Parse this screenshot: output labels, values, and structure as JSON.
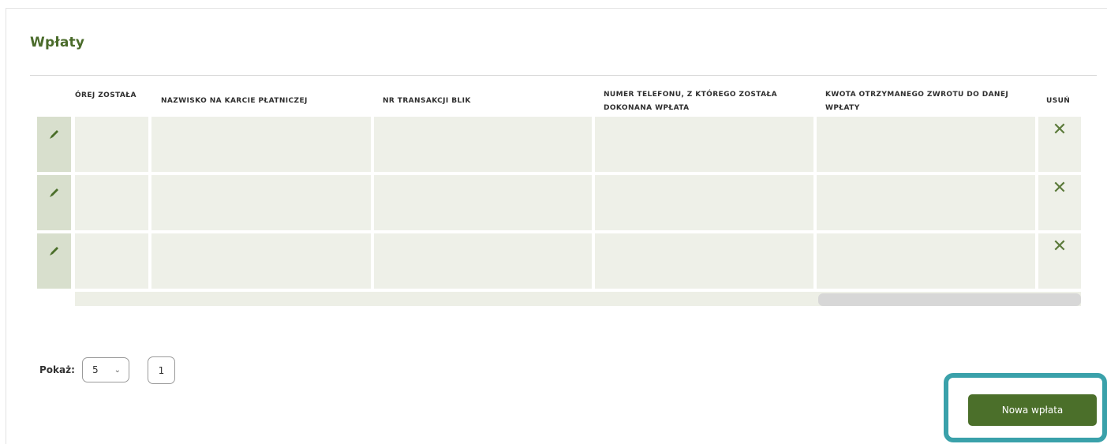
{
  "section": {
    "title": "Wpłaty"
  },
  "table": {
    "headers": [
      {
        "label": "ÓREJ ZOSTAŁA"
      },
      {
        "label": "NAZWISKO NA KARCIE PŁATNICZEJ"
      },
      {
        "label": "NR TRANSAKCJI BLIK"
      },
      {
        "label": "NUMER TELEFONU, Z KTÓREGO ZOSTAŁA DOKONANA WPŁATA"
      },
      {
        "label": "KWOTA OTRZYMANEGO ZWROTU DO DANEJ WPŁATY"
      },
      {
        "label": "USUŃ"
      }
    ],
    "rows": [
      {
        "cells": [
          "",
          "",
          "",
          "",
          ""
        ]
      },
      {
        "cells": [
          "",
          "",
          "",
          "",
          ""
        ]
      },
      {
        "cells": [
          "",
          "",
          "",
          "",
          ""
        ]
      }
    ],
    "delete_glyph": "✕",
    "edit_icon": "pencil-icon",
    "delete_icon": "close-icon"
  },
  "pagination": {
    "show_label": "Pokaż:",
    "page_size_value": "5",
    "current_page": "1"
  },
  "actions": {
    "new_payment_label": "Nowa wpłata"
  },
  "colors": {
    "brand_green": "#4b6f2a",
    "title_green": "#4a6b2a",
    "cell_bg": "#eef0e8",
    "edit_bg": "#d8dfcd",
    "highlight": "#3aa1aa"
  }
}
